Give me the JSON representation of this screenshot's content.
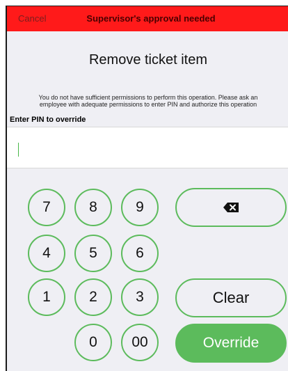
{
  "header": {
    "cancel_label": "Cancel",
    "title": "Supervisor's approval needed",
    "background_color": "#ff1a1a"
  },
  "dialog": {
    "title": "Remove ticket item",
    "message_line1": "You do not have sufficient permissions to perform this operation.  Please ask an",
    "message_line2": "employee with adequate permissions to enter PIN and authorize this operation"
  },
  "pin": {
    "label": "Enter PIN to override",
    "value": ""
  },
  "keypad": {
    "keys": {
      "k7": "7",
      "k8": "8",
      "k9": "9",
      "k4": "4",
      "k5": "5",
      "k6": "6",
      "k1": "1",
      "k2": "2",
      "k3": "3",
      "k0": "0",
      "k00": "00"
    },
    "backspace_icon": "backspace-icon",
    "clear_label": "Clear",
    "override_label": "Override",
    "accent_color": "#5cbb5c"
  }
}
